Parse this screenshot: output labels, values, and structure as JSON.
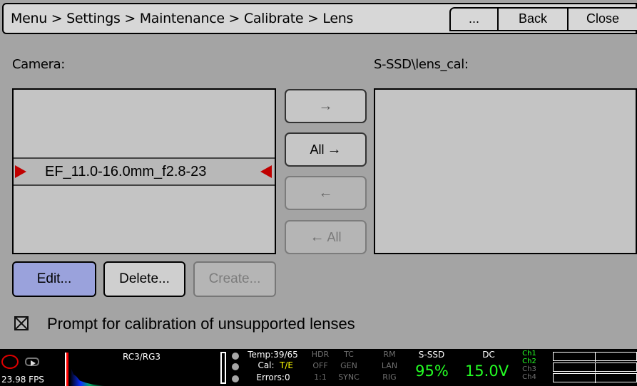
{
  "header": {
    "breadcrumb": "Menu > Settings > Maintenance > Calibrate > Lens",
    "more_label": "...",
    "back_label": "Back",
    "close_label": "Close"
  },
  "camera_panel": {
    "label": "Camera:",
    "selected_item": "EF_11.0-16.0mm_f2.8-23"
  },
  "ssd_panel": {
    "label": "S-SSD\\lens_cal:"
  },
  "transfer_buttons": {
    "move_right": "→",
    "all_right": "All",
    "all_right_icon": "→",
    "move_left": "←",
    "all_left_icon": "←",
    "all_left": "All"
  },
  "actions": {
    "edit": "Edit...",
    "delete": "Delete...",
    "create": "Create..."
  },
  "settings": {
    "prompt_checked": true,
    "prompt_label": "Prompt for calibration of unsupported lenses"
  },
  "status_bar": {
    "fps": "23.98 FPS",
    "rc": "RC3/RG3",
    "temp": "Temp:39/65",
    "cal_prefix": "Cal:",
    "cal_value": "T/E",
    "errors": "Errors:0",
    "hdr": "HDR",
    "off": "OFF",
    "ratio": "1:1",
    "tc": "TC",
    "gen": "GEN",
    "sync": "SYNC",
    "rm": "RM",
    "lan": "LAN",
    "rig": "RIG",
    "media_label": "S-SSD",
    "media_percent": "95%",
    "power_label": "DC",
    "power_value": "15.0V",
    "channels": [
      "Ch1",
      "Ch2",
      "Ch3",
      "Ch4"
    ],
    "colors": {
      "accent": "#24ff24",
      "record": "#ff0000",
      "edit_button": "#9aa2dc"
    }
  }
}
